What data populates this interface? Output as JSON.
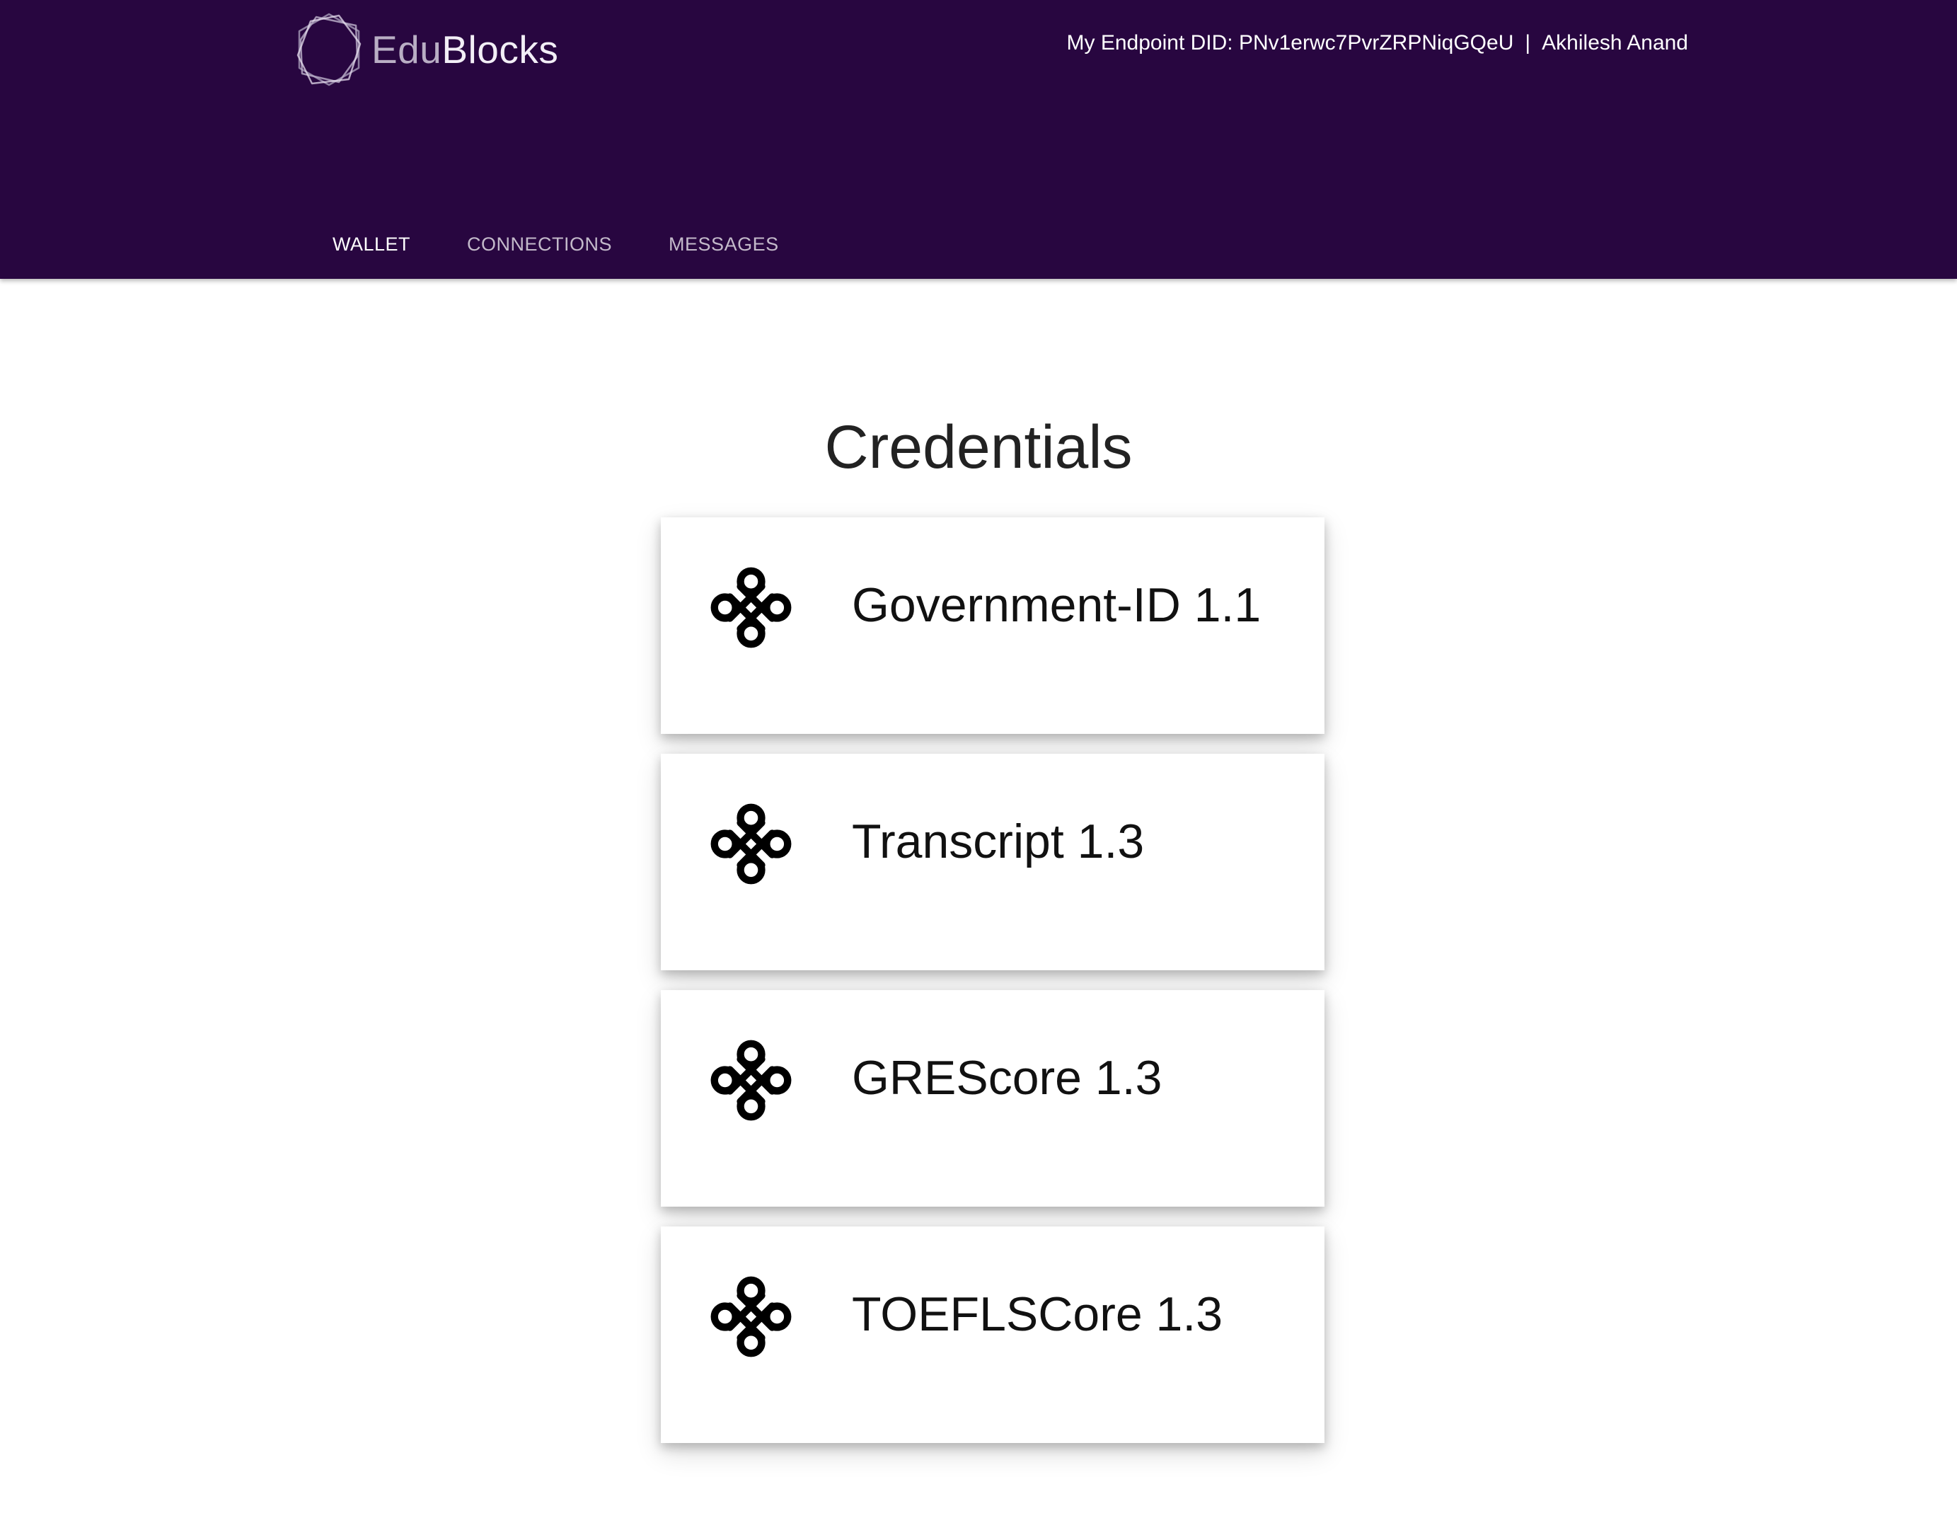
{
  "app": {
    "logo_text_light": "Edu",
    "logo_text_bold": "Blocks",
    "brand_color": "#280640"
  },
  "header": {
    "endpoint_did": "My Endpoint DID: PNv1erwc7PvrZRPNiqGQeU",
    "separator": "|",
    "user_name": "Akhilesh Anand"
  },
  "nav": {
    "tabs": [
      {
        "label": "WALLET",
        "active": true
      },
      {
        "label": "CONNECTIONS",
        "active": false
      },
      {
        "label": "MESSAGES",
        "active": false
      }
    ]
  },
  "main": {
    "title": "Credentials",
    "credentials": [
      {
        "label": "Government-ID 1.1",
        "icon": "knot-icon"
      },
      {
        "label": "Transcript 1.3",
        "icon": "knot-icon"
      },
      {
        "label": "GREScore 1.3",
        "icon": "knot-icon"
      },
      {
        "label": "TOEFLSCore 1.3",
        "icon": "knot-icon"
      }
    ]
  }
}
